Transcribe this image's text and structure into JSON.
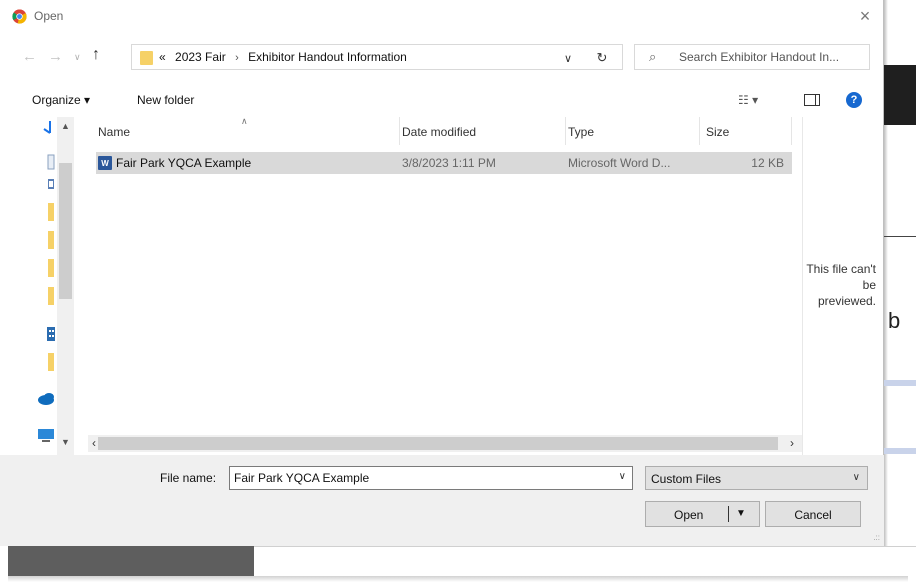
{
  "window": {
    "title": "Open",
    "close_label": "×"
  },
  "nav": {
    "back": "←",
    "forward": "→",
    "recent": "∨",
    "up": "↑"
  },
  "address": {
    "overflow": "«",
    "crumbs": [
      "2023 Fair",
      "Exhibitor Handout Information"
    ],
    "separator": "›",
    "dropdown": "∨",
    "refresh": "↻"
  },
  "search": {
    "placeholder": "Search Exhibitor Handout In..."
  },
  "toolbar": {
    "organize": "Organize ▾",
    "new_folder": "New folder",
    "view": "☷ ▾",
    "help": "?"
  },
  "columns": {
    "name": "Name",
    "date": "Date modified",
    "type": "Type",
    "size": "Size"
  },
  "files": [
    {
      "name": "Fair Park YQCA Example",
      "date": "3/8/2023 1:11 PM",
      "type": "Microsoft Word D...",
      "size": "12 KB",
      "icon": "word-doc-icon"
    }
  ],
  "preview": {
    "text": "This file can't be previewed."
  },
  "bottom": {
    "file_name_label": "File name:",
    "file_name_value": "Fair Park YQCA Example",
    "filter_value": "Custom Files",
    "open_label": "Open",
    "cancel_label": "Cancel"
  },
  "background": {
    "partial_letter": "b"
  },
  "colors": {
    "selected_row": "#d9d9d9",
    "help_blue": "#1668d0",
    "folder_yellow": "#f6d167",
    "word_blue": "#2b579a",
    "bottom_panel": "#f0f0f0"
  }
}
